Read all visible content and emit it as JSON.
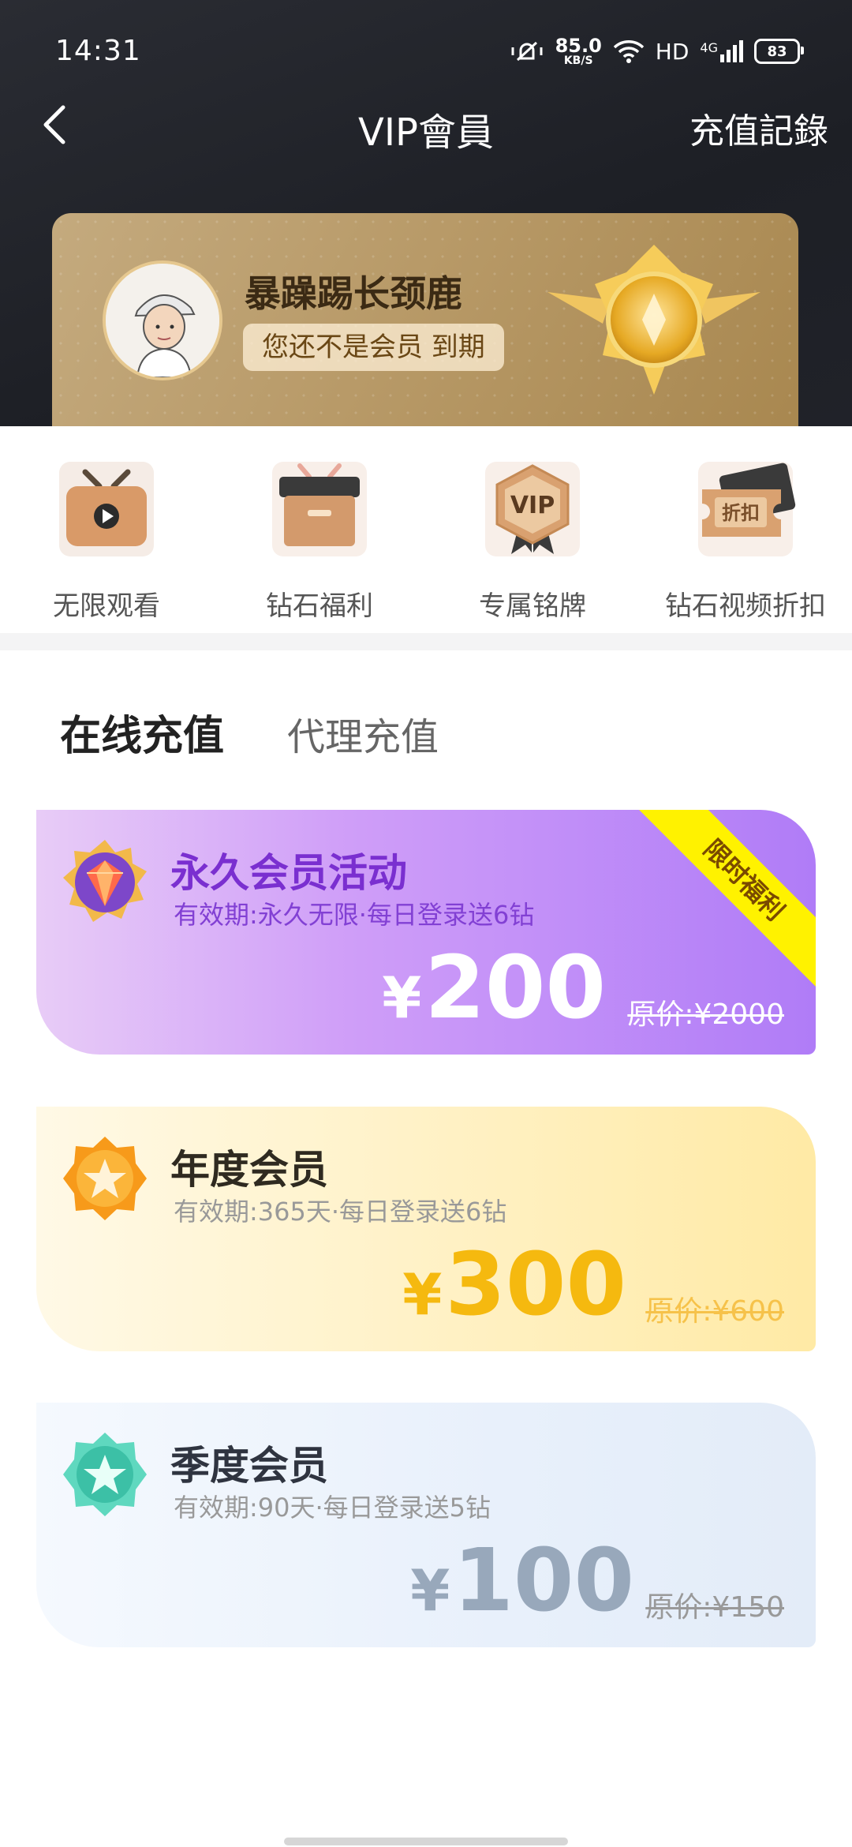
{
  "status_bar": {
    "time": "14:31",
    "net_speed": "85.0",
    "net_unit": "KB/S",
    "hd": "HD",
    "signal": "4G",
    "battery": "83"
  },
  "nav": {
    "title": "VIP會員",
    "right_link": "充值記錄"
  },
  "member": {
    "name": "暴躁踢长颈鹿",
    "status": "您还不是会员 到期"
  },
  "benefits": [
    {
      "label": "无限观看",
      "icon": "tv-play-icon"
    },
    {
      "label": "钻石福利",
      "icon": "gift-box-icon"
    },
    {
      "label": "专属铭牌",
      "icon": "vip-badge-icon"
    },
    {
      "label": "钻石视频折扣",
      "icon": "discount-ticket-icon"
    }
  ],
  "tabs": {
    "online": "在线充值",
    "agent": "代理充值"
  },
  "plans": [
    {
      "title": "永久会员活动",
      "subtitle": "有效期:永久无限·每日登录送6钻",
      "currency": "¥",
      "price": "200",
      "original": "原价:¥2000",
      "ribbon": "限时福利",
      "icon": "diamond-medal-icon",
      "colors": {
        "accent": "#b07cf7"
      }
    },
    {
      "title": "年度会员",
      "subtitle": "有效期:365天·每日登录送6钻",
      "currency": "¥",
      "price": "300",
      "original": "原价:¥600",
      "icon": "gold-star-badge-icon",
      "colors": {
        "accent": "#f5b90f"
      }
    },
    {
      "title": "季度会员",
      "subtitle": "有效期:90天·每日登录送5钻",
      "currency": "¥",
      "price": "100",
      "original": "原价:¥150",
      "icon": "teal-star-badge-icon",
      "colors": {
        "accent": "#98a8bb"
      }
    }
  ]
}
